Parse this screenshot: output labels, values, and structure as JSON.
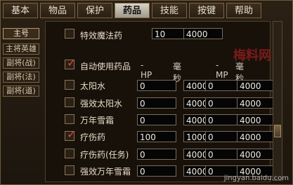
{
  "tabs": [
    "基本",
    "物品",
    "保护",
    "药品",
    "技能",
    "按键",
    "帮助"
  ],
  "side": [
    "主号",
    "主将英雄",
    "副将(战)",
    "副将(法)",
    "副将(道)"
  ],
  "top_item": {
    "label": "特效魔法药",
    "value1": "10",
    "value2": "4000",
    "checked": false
  },
  "header": {
    "label": "自动使用药品",
    "hp": "-HP",
    "ms1": "毫秒",
    "mp": "-MP",
    "ms2": "毫秒",
    "checked": true
  },
  "items": [
    {
      "label": "太阳水",
      "hp": "0",
      "ms1": "4000",
      "mp": "0",
      "ms2": "4000",
      "checked": false
    },
    {
      "label": "强效太阳水",
      "hp": "0",
      "ms1": "4000",
      "mp": "0",
      "ms2": "4000",
      "checked": false
    },
    {
      "label": "万年雪霜",
      "hp": "0",
      "ms1": "4000",
      "mp": "0",
      "ms2": "4000",
      "checked": false
    },
    {
      "label": "疗伤药",
      "hp": "100",
      "ms1": "1000",
      "mp": "0",
      "ms2": "4000",
      "checked": true
    },
    {
      "label": "疗伤药(任务)",
      "hp": "0",
      "ms1": "4000",
      "mp": "0",
      "ms2": "4000",
      "checked": false
    },
    {
      "label": "强效万年雪霜",
      "hp": "0",
      "ms1": "4000",
      "mp": "0",
      "ms2": "4000",
      "checked": false
    }
  ],
  "watermark1": "梅料网",
  "watermark2": "jingyan.baidu.com"
}
